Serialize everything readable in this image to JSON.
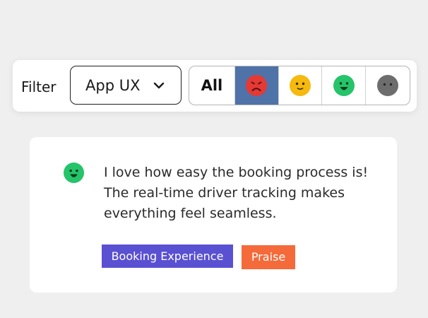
{
  "filter": {
    "label": "Filter",
    "dropdown": {
      "selected": "App UX",
      "icon": "chevron-down-icon"
    },
    "segments": [
      {
        "id": "all",
        "label": "All"
      },
      {
        "id": "negative",
        "icon": "sad-face-icon",
        "color": "#e53935",
        "active": true
      },
      {
        "id": "neutral",
        "icon": "neutral-face-icon",
        "color": "#f5b90f"
      },
      {
        "id": "positive",
        "icon": "happy-face-icon",
        "color": "#25c46a"
      },
      {
        "id": "unrated",
        "icon": "blank-face-icon",
        "color": "#6d6d6d"
      }
    ],
    "active_color": "#4f72a8"
  },
  "feedback": {
    "sentiment_icon": "happy-face-icon",
    "text": "I love how easy the booking process is! The real-time driver tracking makes everything feel seamless.",
    "tags": [
      {
        "label": "Booking Experience",
        "color": "#5a50d2"
      },
      {
        "label": "Praise",
        "color": "#f46a3a"
      }
    ]
  }
}
